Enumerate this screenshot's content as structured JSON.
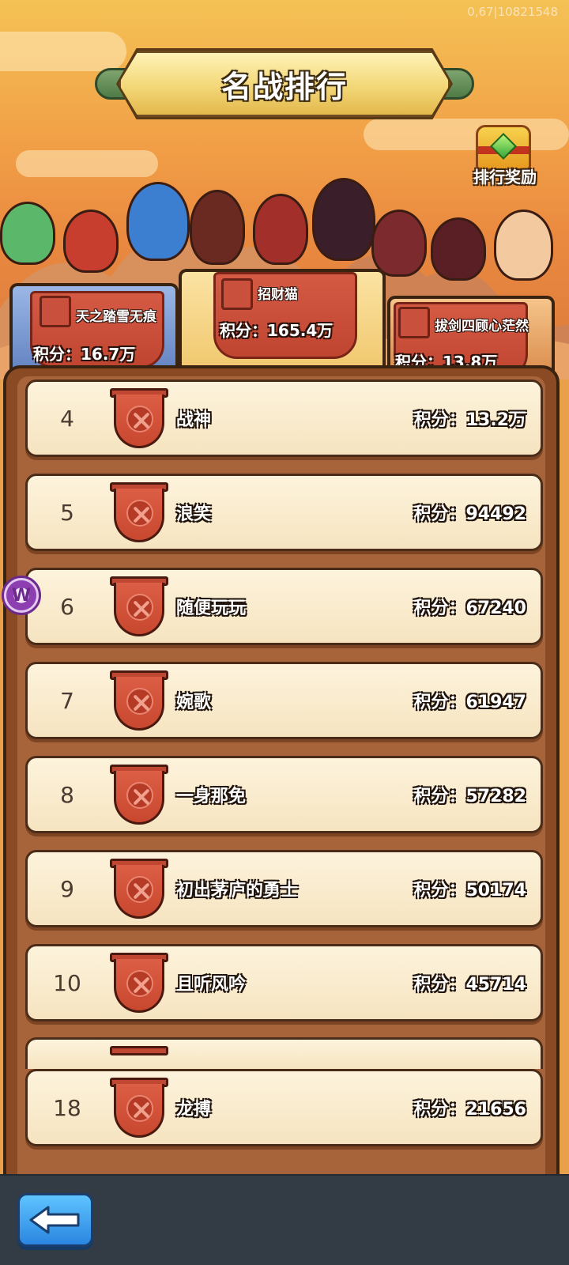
{
  "debug": {
    "text": "0,67|10821548"
  },
  "title": "名战排行",
  "reward": {
    "label": "排行奖励",
    "icon": "treasure-chest-icon"
  },
  "podium": [
    {
      "place": 2,
      "name": "天之踏雪无痕",
      "score": "积分：16.7万"
    },
    {
      "place": 1,
      "name": "招财猫",
      "score": "积分：165.4万"
    },
    {
      "place": 3,
      "name": "拔剑四顾心茫然",
      "score": "积分：13.8万"
    }
  ],
  "ranks": [
    {
      "rank": "4",
      "name": "战神",
      "score": "积分：13.2万"
    },
    {
      "rank": "5",
      "name": "浪笑",
      "score": "积分：94492"
    },
    {
      "rank": "6",
      "name": "随便玩玩",
      "score": "积分：67240"
    },
    {
      "rank": "7",
      "name": "婉歌",
      "score": "积分：61947"
    },
    {
      "rank": "8",
      "name": "一身那免",
      "score": "积分：57282"
    },
    {
      "rank": "9",
      "name": "初出茅庐的勇士",
      "score": "积分：50174"
    },
    {
      "rank": "10",
      "name": "且听风吟",
      "score": "积分：45714"
    }
  ],
  "self": {
    "rank": "18",
    "name": "龙搏",
    "score": "积分：21656"
  },
  "side_widget": {
    "glyph": "W"
  },
  "back": {
    "icon": "back-arrow-icon"
  },
  "colors": {
    "card_bg": "#f6e4c0",
    "panel_bg": "#8a4a24",
    "bottom_bar": "#333b44",
    "back_button": "#2a86e0"
  }
}
